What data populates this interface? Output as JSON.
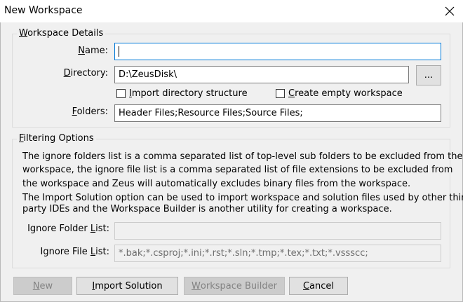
{
  "window": {
    "title": "New Workspace",
    "close_icon": "close-icon"
  },
  "workspace_details": {
    "legend_first": "W",
    "legend_rest": "orkspace Details",
    "name_label_first": "N",
    "name_label_rest": "ame:",
    "name_value": "",
    "directory_label_first": "D",
    "directory_label_rest": "irectory:",
    "directory_value": "D:\\ZeusDisk\\",
    "browse_label": "...",
    "import_dir_first": "I",
    "import_dir_rest": "mport directory structure",
    "import_dir_checked": false,
    "create_empty_first": "C",
    "create_empty_rest": "reate empty workspace",
    "create_empty_checked": false,
    "folders_label_first": "F",
    "folders_label_rest": "olders:",
    "folders_value": "Header Files;Resource Files;Source Files;"
  },
  "filtering_options": {
    "legend_first": "F",
    "legend_rest": "iltering Options",
    "description_lines": [
      "The ignore folders list is a comma separated list of top-level sub folders to be excluded from the",
      "workspace, the ignore file list is a comma separated list of file extensions to be excluded from",
      "the workspace and Zeus will automatically excludes binary files from the workspace.",
      "The Import Solution option can be used to import workspace and solution files used by other third",
      "party IDEs and the Workspace Builder is another utility for creating a workspace."
    ],
    "ignore_folder_label_pre": "Ignore Folder ",
    "ignore_folder_label_ul": "L",
    "ignore_folder_label_post": "ist:",
    "ignore_folder_value": "",
    "ignore_file_label_pre": "Ignore File ",
    "ignore_file_label_ul": "L",
    "ignore_file_label_post": "ist:",
    "ignore_file_value": "*.bak;*.csproj;*.ini;*.rst;*.sln;*.tmp;*.tex;*.txt;*.vssscc;"
  },
  "buttons": {
    "new_first": "N",
    "new_rest": "ew",
    "import_first": "I",
    "import_rest": "mport Solution",
    "builder_first": "W",
    "builder_rest": "orkspace Builder",
    "cancel_first": "C",
    "cancel_rest": "ancel"
  }
}
